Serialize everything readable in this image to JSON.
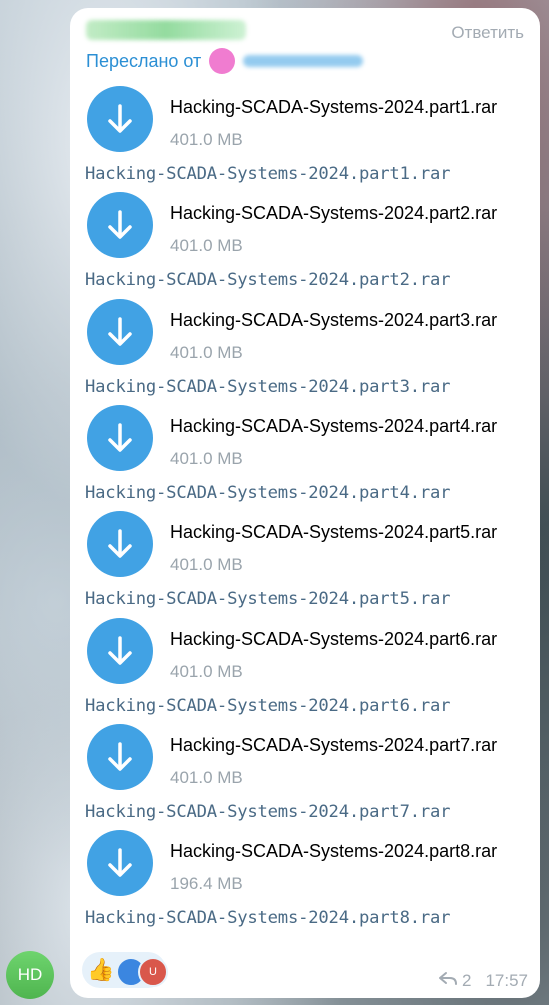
{
  "message": {
    "reply_label": "Ответить",
    "forwarded_label": "Переслано от",
    "files": [
      {
        "name": "Hacking-SCADA-Systems-2024.part1.rar",
        "size": "401.0 MB",
        "caption": "Hacking-SCADA-Systems-2024.part1.rar"
      },
      {
        "name": "Hacking-SCADA-Systems-2024.part2.rar",
        "size": "401.0 MB",
        "caption": "Hacking-SCADA-Systems-2024.part2.rar"
      },
      {
        "name": "Hacking-SCADA-Systems-2024.part3.rar",
        "size": "401.0 MB",
        "caption": "Hacking-SCADA-Systems-2024.part3.rar"
      },
      {
        "name": "Hacking-SCADA-Systems-2024.part4.rar",
        "size": "401.0 MB",
        "caption": "Hacking-SCADA-Systems-2024.part4.rar"
      },
      {
        "name": "Hacking-SCADA-Systems-2024.part5.rar",
        "size": "401.0 MB",
        "caption": "Hacking-SCADA-Systems-2024.part5.rar"
      },
      {
        "name": "Hacking-SCADA-Systems-2024.part6.rar",
        "size": "401.0 MB",
        "caption": "Hacking-SCADA-Systems-2024.part6.rar"
      },
      {
        "name": "Hacking-SCADA-Systems-2024.part7.rar",
        "size": "401.0 MB",
        "caption": "Hacking-SCADA-Systems-2024.part7.rar"
      },
      {
        "name": "Hacking-SCADA-Systems-2024.part8.rar",
        "size": "196.4 MB",
        "caption": "Hacking-SCADA-Systems-2024.part8.rar"
      }
    ],
    "reactions": {
      "emoji": "👍",
      "avatar2_initial": "U"
    },
    "forward_count": "2",
    "time": "17:57",
    "share_icon": "share-arrow-icon"
  },
  "sender_avatar": {
    "initials": "HD"
  },
  "colors": {
    "accent": "#41a2e4",
    "link": "#2b8fd4",
    "caption": "#4a6a85",
    "muted": "#9aa4ac",
    "avatar_green": "#5cc45c"
  }
}
